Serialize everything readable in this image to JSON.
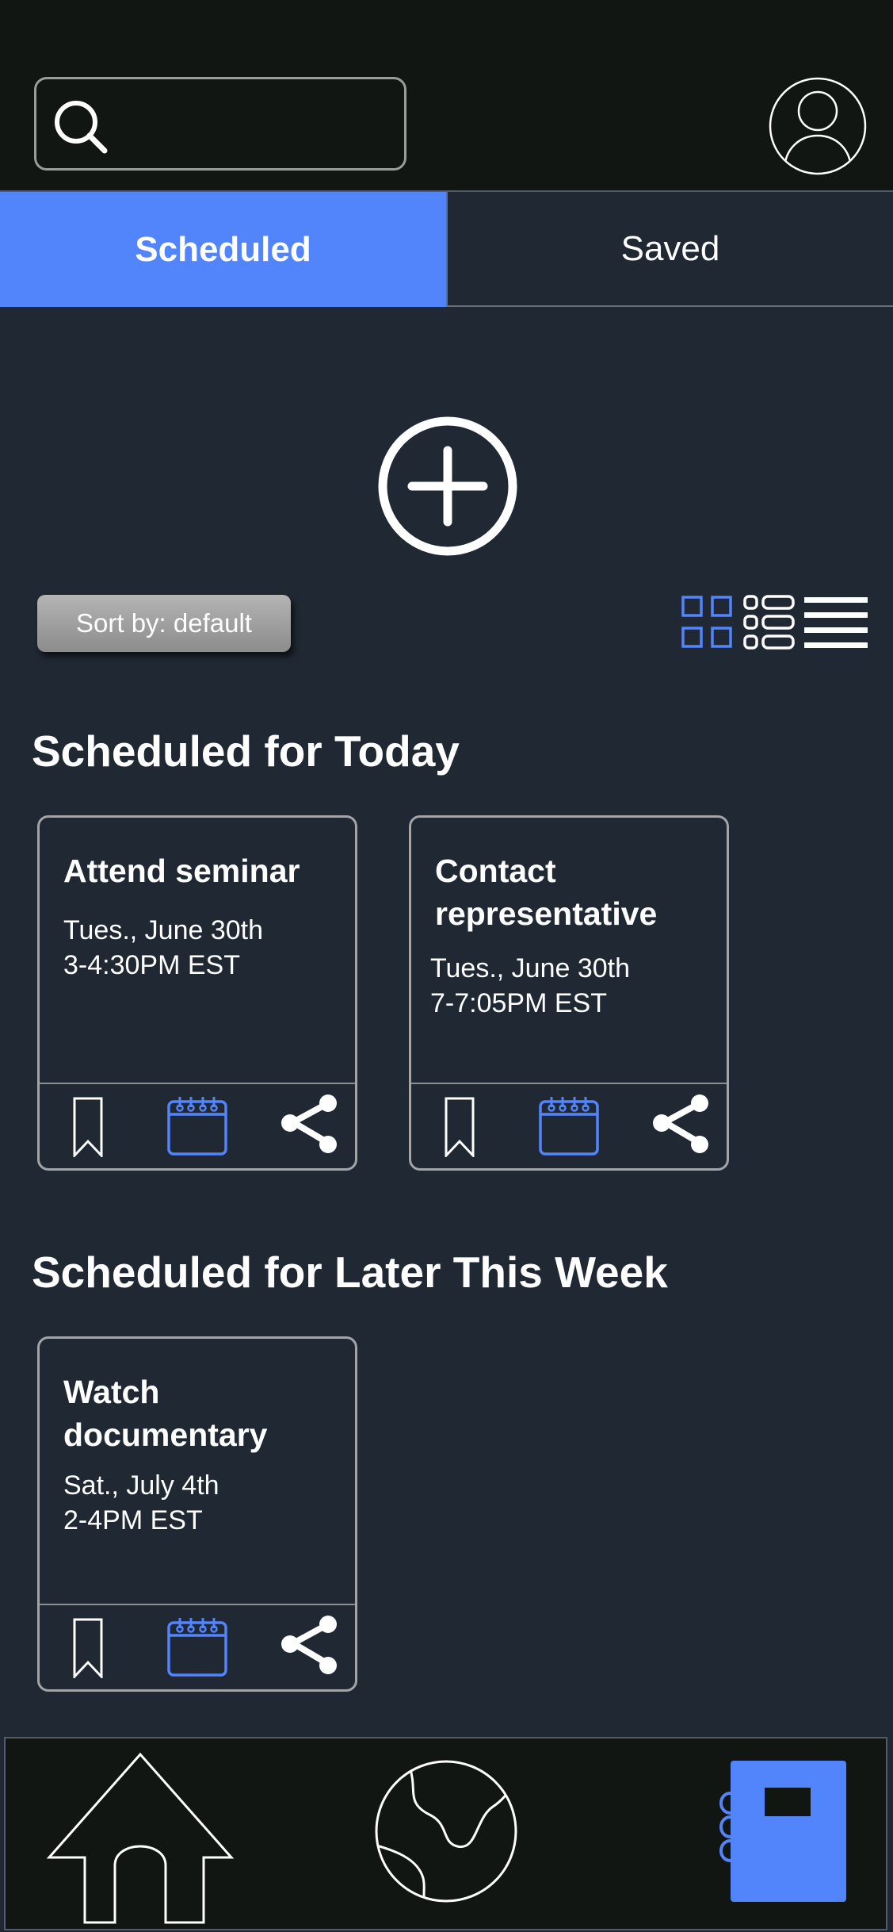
{
  "tabs": {
    "scheduled": "Scheduled",
    "saved": "Saved"
  },
  "sort": {
    "label": "Sort by: default"
  },
  "sections": {
    "today": "Scheduled for Today",
    "week": "Scheduled for Later This Week"
  },
  "cards": [
    {
      "title": "Attend seminar",
      "date": "Tues., June 30th",
      "time": "3-4:30PM EST"
    },
    {
      "title": "Contact representative",
      "date": "Tues., June 30th",
      "time": "7-7:05PM EST"
    },
    {
      "title": "Watch documentary",
      "date": "Sat., July 4th",
      "time": "2-4PM EST"
    }
  ],
  "colors": {
    "accent": "#5284fc",
    "background": "#202833",
    "bar": "#121612"
  },
  "icons": [
    "search-icon",
    "user-avatar-icon",
    "add-icon",
    "grid-view-icon",
    "card-list-view-icon",
    "list-view-icon",
    "bookmark-icon",
    "calendar-icon",
    "share-icon",
    "home-icon",
    "globe-icon",
    "planner-icon"
  ]
}
